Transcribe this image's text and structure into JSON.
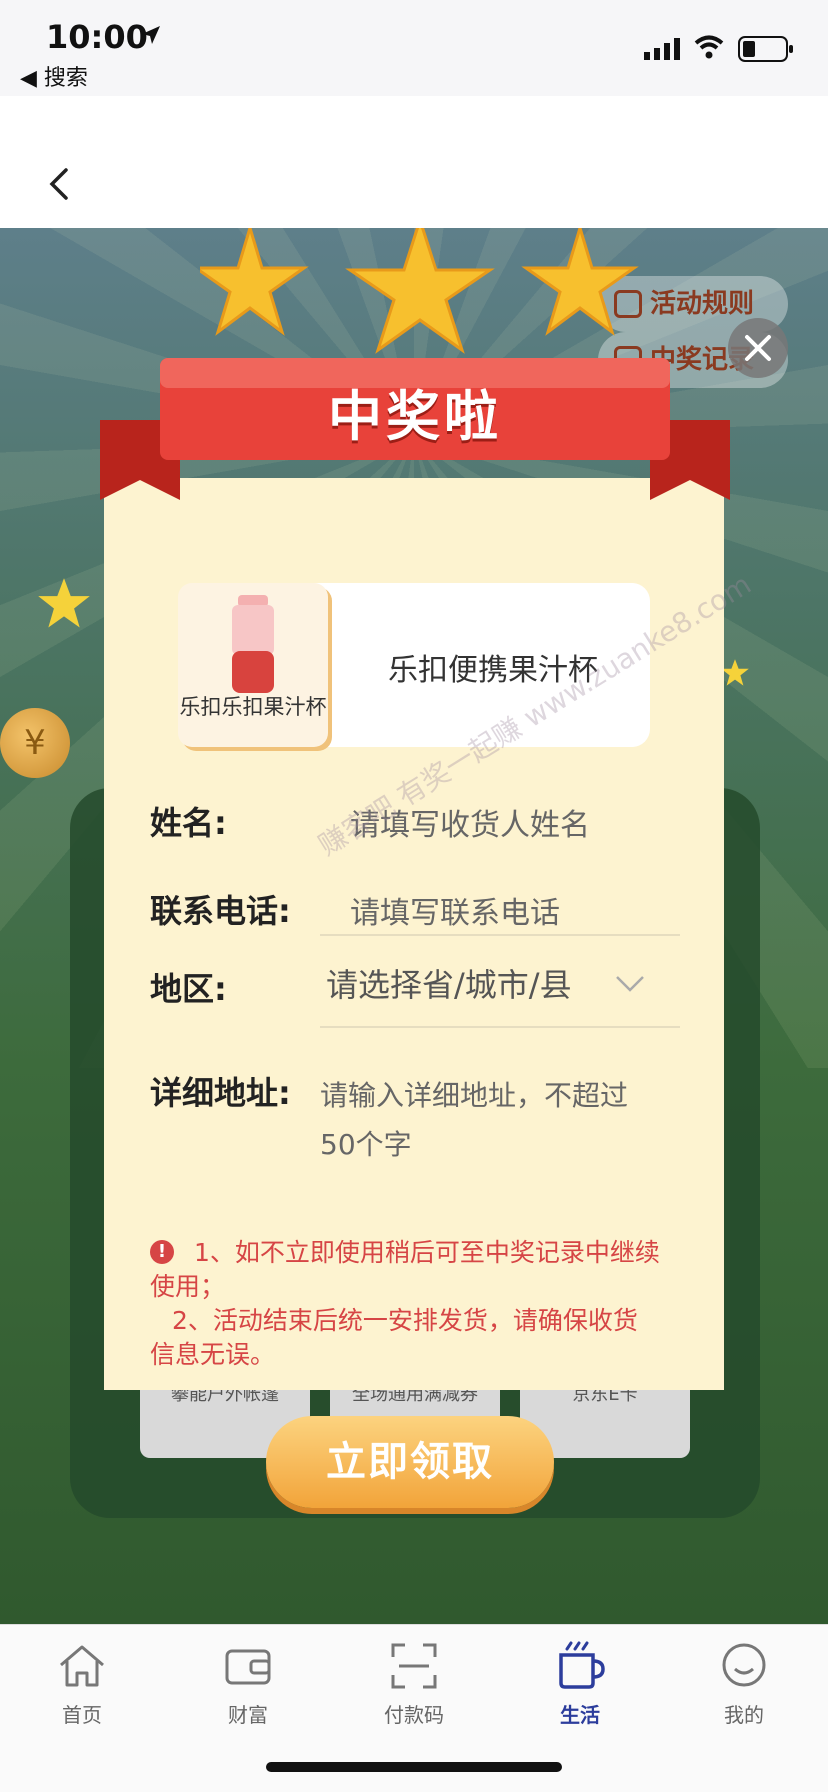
{
  "status_bar": {
    "time": "10:00",
    "back_app": "◀ 搜索"
  },
  "game": {
    "rules_label": "活动规则",
    "record_label": "中奖记录",
    "bg_prizes": [
      "攀能户外帐篷",
      "全场通用满减券",
      "京东E卡"
    ],
    "coin_symbol": "¥"
  },
  "dialog": {
    "title": "中奖啦",
    "prize_thumb_label": "乐扣乐扣果汁杯",
    "prize_name": "乐扣便携果汁杯",
    "fields": {
      "name_label": "姓名:",
      "name_placeholder": "请填写收货人姓名",
      "phone_label": "联系电话:",
      "phone_placeholder": "请填写联系电话",
      "region_label": "地区:",
      "region_placeholder": "请选择省/城市/县",
      "address_label": "详细地址:",
      "address_placeholder_line1": "请输入详细地址，不超过",
      "address_placeholder_line2": "50个字"
    },
    "notice_icon": "!",
    "notice_1a": "1、如不立即使用稍后可至中奖记录中继续",
    "notice_1b": "使用；",
    "notice_2a": "2、活动结束后统一安排发货，请确保收货",
    "notice_2b": "信息无误。",
    "claim_button": "立即领取"
  },
  "watermark": "赚客吧 有奖一起赚 www.zuanke8.com",
  "tabs": [
    {
      "label": "首页",
      "icon": "home-icon"
    },
    {
      "label": "财富",
      "icon": "wallet-icon"
    },
    {
      "label": "付款码",
      "icon": "scan-icon"
    },
    {
      "label": "生活",
      "icon": "cup-icon"
    },
    {
      "label": "我的",
      "icon": "profile-icon"
    }
  ],
  "colors": {
    "accent": "#2c3d9c",
    "notice": "#d64545",
    "dialog_bg": "#fdf3d0",
    "ribbon": "#e8423a"
  }
}
